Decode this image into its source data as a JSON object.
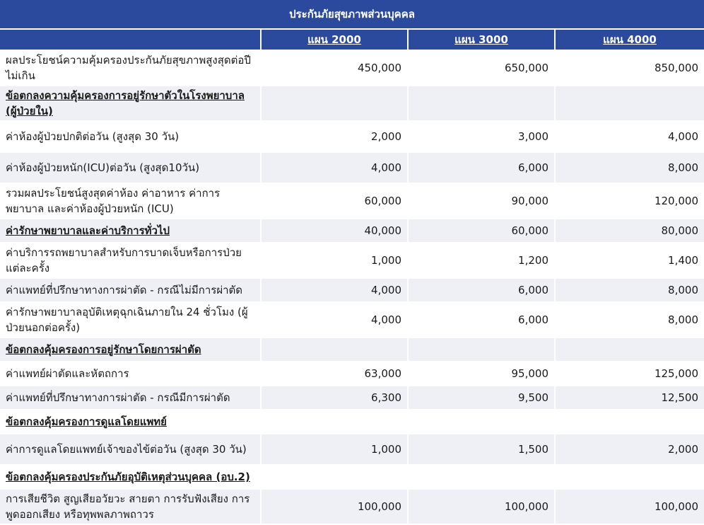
{
  "header": {
    "title": "ประกันภัยสุขภาพส่วนบุคคล",
    "plans": [
      "แผน 2000",
      "แผน 3000",
      "แผน 4000"
    ]
  },
  "rows": [
    {
      "label": "ผลประโยชน์ความคุ้มครองประกันภัยสุขภาพสูงสุดต่อปีไม่เกิน",
      "v": [
        "450,000",
        "650,000",
        "850,000"
      ]
    },
    {
      "label": "ข้อตกลงความคุ้มครองการอยู่รักษาตัวในโรงพยาบาล (ผู้ป่วยใน)",
      "v": [
        "",
        "",
        ""
      ]
    },
    {
      "label": "ค่าห้องผู้ป่วยปกติต่อวัน (สูงสุด 30 วัน)",
      "v": [
        "2,000",
        "3,000",
        "4,000"
      ]
    },
    {
      "label": "ค่าห้องผู้ป่วยหนัก(ICU)ต่อวัน (สูงสุด10วัน)",
      "v": [
        "4,000",
        "6,000",
        "8,000"
      ]
    },
    {
      "label": "รวมผลประโยชน์สูงสุดค่าห้อง ค่าอาหาร ค่าการพยาบาล และค่าห้องผู้ป่วยหนัก (ICU)",
      "v": [
        "60,000",
        "90,000",
        "120,000"
      ]
    },
    {
      "label": "ค่ารักษาพยาบาลและค่าบริการทั่วไป",
      "v": [
        "40,000",
        "60,000",
        "80,000"
      ]
    },
    {
      "label": "ค่าบริการรถพยาบาลสำหรับการบาดเจ็บหรือการป่วยแต่ละครั้ง",
      "v": [
        "1,000",
        "1,200",
        "1,400"
      ]
    },
    {
      "label": "ค่าแพทย์ที่ปรึกษาทางการผ่าตัด - กรณีไม่มีการผ่าตัด",
      "v": [
        "4,000",
        "6,000",
        "8,000"
      ]
    },
    {
      "label": "ค่ารักษาพยาบาลอุบัติเหตุฉุกเฉินภายใน 24 ชั่วโมง (ผู้ป่วยนอกต่อครั้ง)",
      "v": [
        "4,000",
        "6,000",
        "8,000"
      ]
    },
    {
      "label": "ข้อตกลงคุ้มครองการอยู่รักษาโดยการผ่าตัด",
      "v": [
        "",
        "",
        ""
      ]
    },
    {
      "label": "ค่าแพทย์ผ่าตัดและหัตถการ",
      "v": [
        "63,000",
        "95,000",
        "125,000"
      ]
    },
    {
      "label": "ค่าแพทย์ที่ปรึกษาทางการผ่าตัด - กรณีมีการผ่าตัด",
      "v": [
        "6,300",
        "9,500",
        "12,500"
      ]
    },
    {
      "label": "ข้อตกลงคุ้มครองการดูแลโดยแพทย์",
      "v": [
        "",
        "",
        ""
      ]
    },
    {
      "label": "ค่าการดูแลโดยแพทย์เจ้าของไข้ต่อวัน (สูงสุด 30 วัน)",
      "v": [
        "1,000",
        "1,500",
        "2,000"
      ]
    },
    {
      "label": "ข้อตกลงคุ้มครองประกันภัยอุบัติเหตุส่วนบุคคล (อบ.2)",
      "v": [
        "",
        "",
        ""
      ]
    },
    {
      "label": "การเสียชีวิต สูญเสียอวัยวะ สายตา การรับฟังเสียง การพูดออกเสียง หรือทุพพลภาพถาวร",
      "v": [
        "100,000",
        "100,000",
        "100,000"
      ]
    }
  ]
}
